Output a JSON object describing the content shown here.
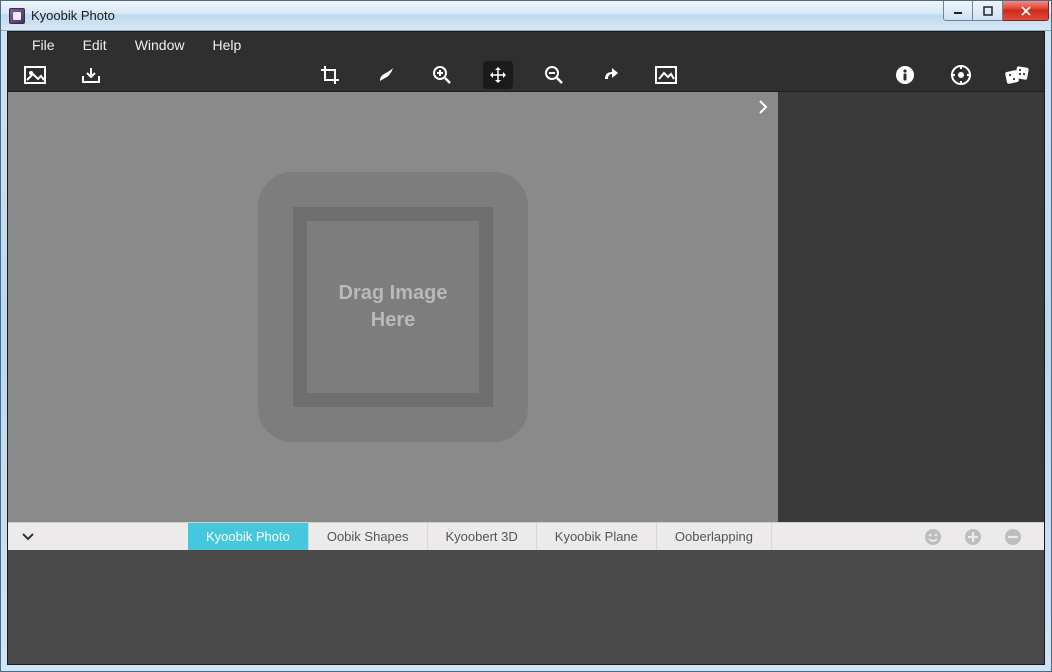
{
  "window": {
    "title": "Kyoobik Photo"
  },
  "menubar": {
    "items": [
      "File",
      "Edit",
      "Window",
      "Help"
    ]
  },
  "toolbar": {
    "left_tools": [
      {
        "name": "open-image-icon"
      },
      {
        "name": "export-icon"
      }
    ],
    "center_tools": [
      {
        "name": "crop-icon",
        "active": false
      },
      {
        "name": "brush-icon",
        "active": false
      },
      {
        "name": "zoom-in-icon",
        "active": false
      },
      {
        "name": "move-icon",
        "active": true
      },
      {
        "name": "zoom-out-icon",
        "active": false
      },
      {
        "name": "redo-icon",
        "active": false
      },
      {
        "name": "fit-image-icon",
        "active": false
      }
    ],
    "right_tools": [
      {
        "name": "info-icon"
      },
      {
        "name": "settings-icon"
      },
      {
        "name": "randomize-icon"
      }
    ]
  },
  "dropzone": {
    "line1": "Drag Image",
    "line2": "Here"
  },
  "tabs": {
    "items": [
      {
        "label": "Kyoobik Photo",
        "active": true
      },
      {
        "label": "Oobik Shapes",
        "active": false
      },
      {
        "label": "Kyoobert 3D",
        "active": false
      },
      {
        "label": "Kyoobik Plane",
        "active": false
      },
      {
        "label": "Ooberlapping",
        "active": false
      }
    ]
  }
}
